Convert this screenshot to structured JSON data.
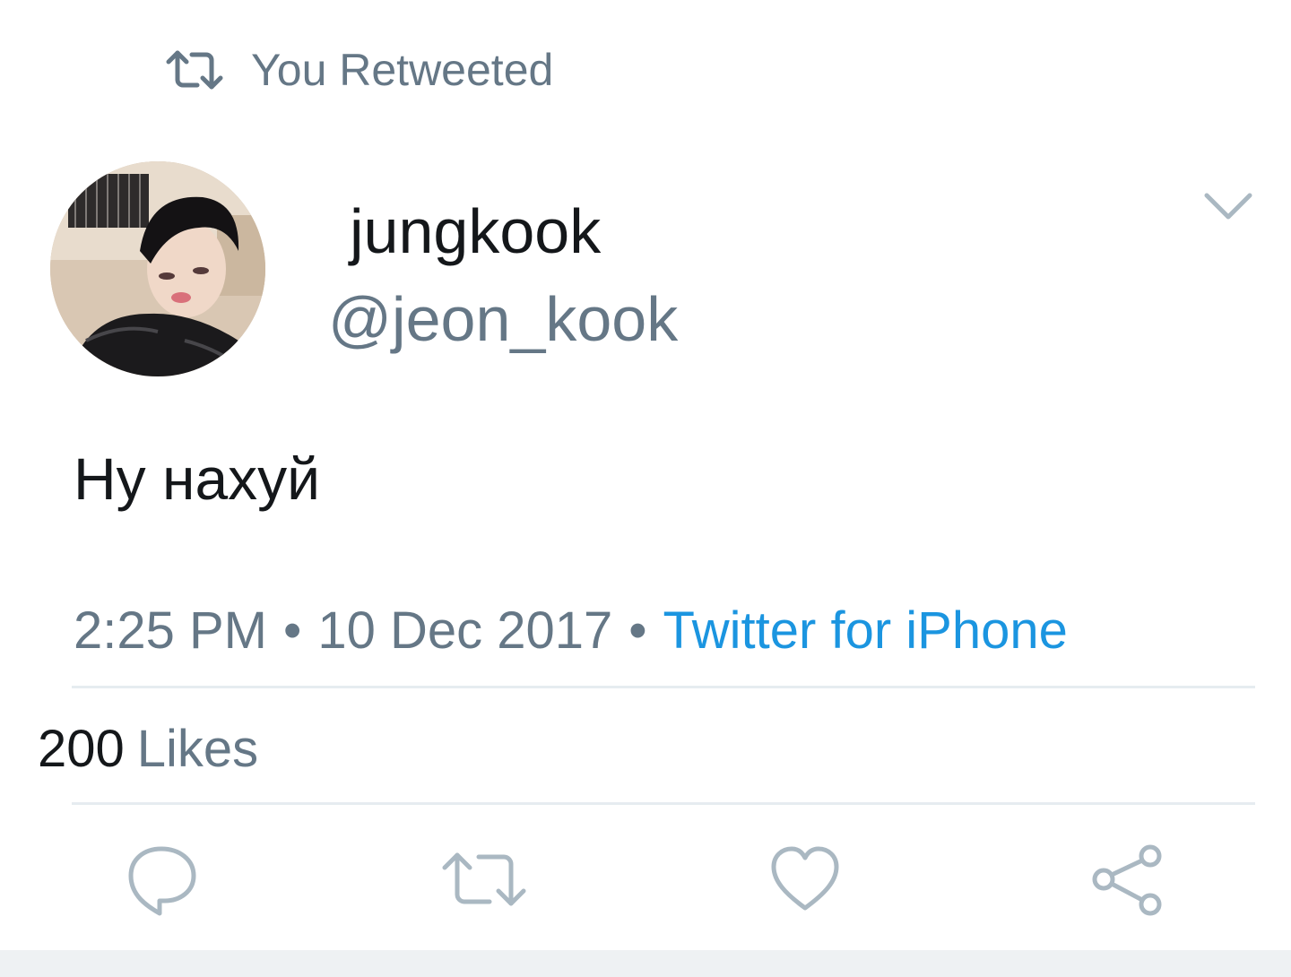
{
  "retweet_banner": {
    "icon": "retweet-icon",
    "text": "You Retweeted"
  },
  "tweet": {
    "author": {
      "display_name": "jungkook",
      "handle": "@jeon_kook",
      "avatar": "profile-photo"
    },
    "menu_icon": "chevron-down-icon",
    "text": "Ну нахуй",
    "time": "2:25 PM",
    "separator": "•",
    "date": "10 Dec 2017",
    "source": "Twitter for iPhone"
  },
  "stats": {
    "likes_count": "200",
    "likes_label": "Likes"
  },
  "actions": [
    {
      "icon": "reply-icon"
    },
    {
      "icon": "retweet-icon"
    },
    {
      "icon": "heart-icon"
    },
    {
      "icon": "share-icon"
    }
  ],
  "colors": {
    "primary_text": "#14171a",
    "secondary_text": "#657786",
    "link": "#1b95e0",
    "divider": "#e6ecf0"
  }
}
